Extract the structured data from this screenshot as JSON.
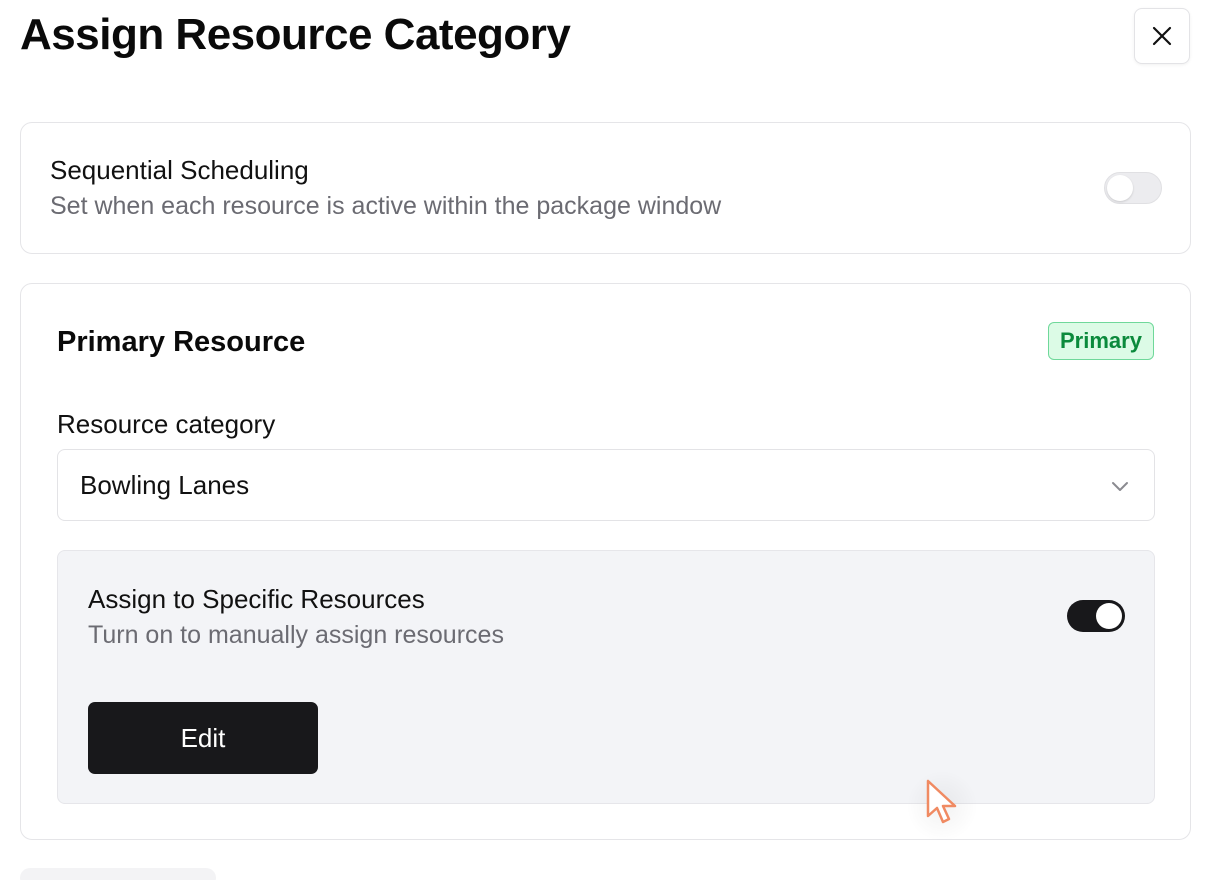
{
  "dialog": {
    "title": "Assign Resource Category"
  },
  "sequential": {
    "title": "Sequential Scheduling",
    "description": "Set when each resource is active within the package window",
    "enabled": false
  },
  "primary": {
    "title": "Primary Resource",
    "badge": "Primary",
    "category_label": "Resource category",
    "category_value": "Bowling Lanes",
    "assign": {
      "title": "Assign to Specific Resources",
      "description": "Turn on to manually assign resources",
      "enabled": true,
      "edit_label": "Edit"
    }
  },
  "colors": {
    "badge_bg": "#dcfbe6",
    "badge_text": "#0b8a3c",
    "dark_button": "#18181b",
    "cursor": "#f08a62"
  }
}
